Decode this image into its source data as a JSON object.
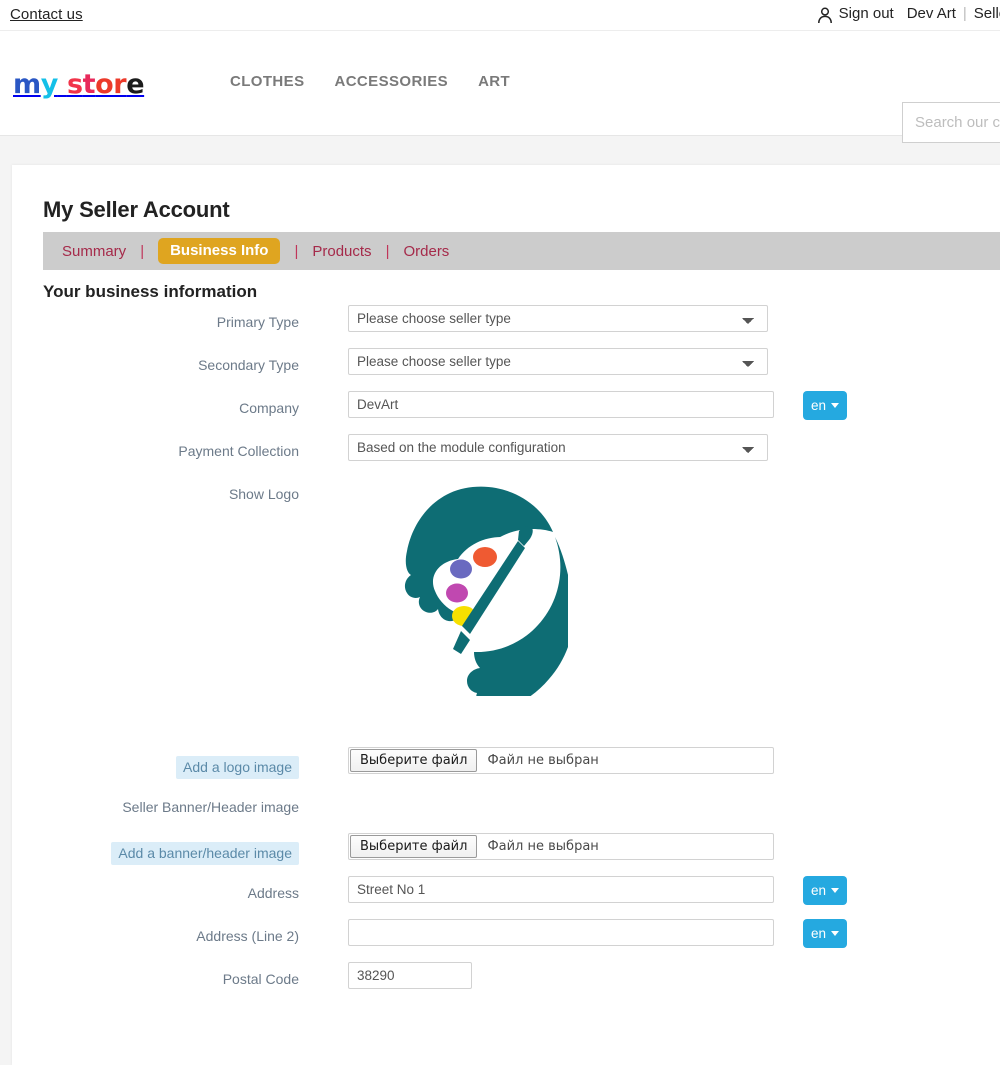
{
  "topbar": {
    "contact_label": "Contact us",
    "person_icon": "person-icon",
    "sign_out_label": "Sign out",
    "account_name": "Dev Art",
    "separator": "|",
    "seller_link_label": "Seller Sig"
  },
  "header": {
    "logo": {
      "part1": "m",
      "part2": "y",
      "part3": "s",
      "part4": "t",
      "part5": "or",
      "part6": "e"
    },
    "nav": [
      {
        "label": "CLOTHES"
      },
      {
        "label": "ACCESSORIES"
      },
      {
        "label": "ART"
      }
    ],
    "search": {
      "placeholder": "Search our c",
      "value": ""
    }
  },
  "page": {
    "title": "My Seller Account",
    "section_title": "Your business information",
    "tabs": [
      {
        "label": "Summary",
        "active": false
      },
      {
        "label": "Business Info",
        "active": true
      },
      {
        "label": "Products",
        "active": false
      },
      {
        "label": "Orders",
        "active": false
      }
    ],
    "tab_separator": "|"
  },
  "form": {
    "primary_type": {
      "label": "Primary Type",
      "value": "Please choose seller type"
    },
    "secondary_type": {
      "label": "Secondary Type",
      "value": "Please choose seller type"
    },
    "company": {
      "label": "Company",
      "value": "DevArt",
      "lang": "en"
    },
    "payment_collection": {
      "label": "Payment Collection",
      "value": "Based on the module configuration"
    },
    "show_logo": {
      "label": "Show Logo"
    },
    "add_logo_image": {
      "label": "Add a logo image",
      "button_label": "Выберите файл",
      "status_text": "Файл не выбран"
    },
    "seller_banner": {
      "label": "Seller Banner/Header image"
    },
    "add_banner_image": {
      "label": "Add a banner/header image",
      "button_label": "Выберите файл",
      "status_text": "Файл не выбран"
    },
    "address": {
      "label": "Address",
      "value": "Street No 1",
      "lang": "en"
    },
    "address_line2": {
      "label": "Address (Line 2)",
      "value": "",
      "lang": "en"
    },
    "postal_code": {
      "label": "Postal Code",
      "value": "38290"
    }
  },
  "colors": {
    "tabbar_bg": "#cccccc",
    "tab_active_bg": "#dfa520",
    "tab_link": "#a52a4a",
    "lang_button": "#25a9e0",
    "label_highlight": "#dbedf8",
    "logo_teal": "#0e6d74",
    "body_bg": "#f4f4f4"
  }
}
